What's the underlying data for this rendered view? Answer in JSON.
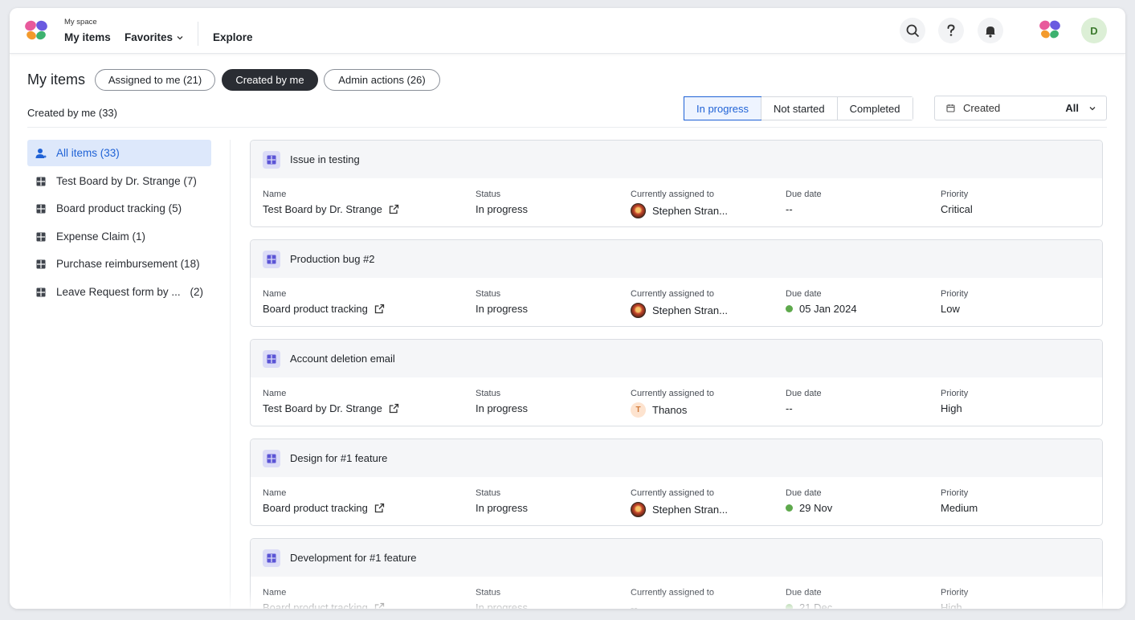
{
  "nav": {
    "space_label": "My space",
    "my_items": "My items",
    "favorites": "Favorites",
    "explore": "Explore",
    "avatar_initial": "D"
  },
  "header": {
    "title": "My items",
    "pills": [
      "Assigned to me (21)",
      "Created by me",
      "Admin actions (26)"
    ],
    "active_pill": "Created by me",
    "subtitle": "Created by me (33)"
  },
  "status_filter": {
    "options": [
      "In progress",
      "Not started",
      "Completed"
    ],
    "active": "In progress"
  },
  "date_filter": {
    "label": "Created",
    "value": "All"
  },
  "sidebar": {
    "items": [
      {
        "label": "All items (33)",
        "count": "",
        "icon": "user-icon",
        "active": true
      },
      {
        "label": "Test Board by Dr. Strange (7)",
        "count": "",
        "icon": "board-icon"
      },
      {
        "label": "Board product tracking (5)",
        "count": "",
        "icon": "board-icon"
      },
      {
        "label": "Expense Claim (1)",
        "count": "",
        "icon": "board-icon"
      },
      {
        "label": "Purchase reimbursement (18)",
        "count": "",
        "icon": "board-icon"
      },
      {
        "label": "Leave Request form by ...",
        "count": "(2)",
        "icon": "board-icon"
      }
    ]
  },
  "columns": {
    "name": "Name",
    "status": "Status",
    "assigned": "Currently assigned to",
    "due": "Due date",
    "priority": "Priority"
  },
  "cards": [
    {
      "title": "Issue in testing",
      "name": "Test Board by Dr. Strange",
      "status": "In progress",
      "assignee": "Stephen Stran...",
      "avatar": "photo",
      "due": "--",
      "due_dot": false,
      "priority": "Critical"
    },
    {
      "title": "Production bug #2",
      "name": "Board product tracking",
      "status": "In progress",
      "assignee": "Stephen Stran...",
      "avatar": "photo",
      "due": "05 Jan 2024",
      "due_dot": true,
      "priority": "Low"
    },
    {
      "title": "Account deletion email",
      "name": "Test Board by Dr. Strange",
      "status": "In progress",
      "assignee": "Thanos",
      "avatar": "T",
      "due": "--",
      "due_dot": false,
      "priority": "High"
    },
    {
      "title": "Design for #1 feature",
      "name": "Board product tracking",
      "status": "In progress",
      "assignee": "Stephen Stran...",
      "avatar": "photo",
      "due": "29 Nov",
      "due_dot": true,
      "priority": "Medium"
    },
    {
      "title": "Development for #1 feature",
      "name": "Board product tracking",
      "status": "In progress",
      "assignee": "--",
      "avatar": "none",
      "due": "21 Dec",
      "due_dot": true,
      "priority": "High"
    }
  ],
  "colors": {
    "accent": "#1f62d6",
    "active_bg": "#dde8fb",
    "green_dot": "#5ea94c",
    "dark_pill": "#2a2d33"
  }
}
